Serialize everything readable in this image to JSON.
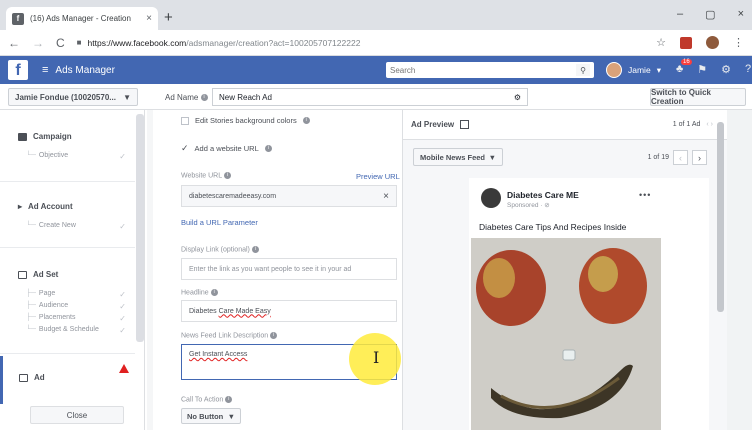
{
  "browser": {
    "tab_title": "(16) Ads Manager - Creation",
    "tab_close": "×",
    "new_tab": "+",
    "back": "←",
    "forward": "→",
    "reload": "C",
    "url_host": "https://www.facebook.com",
    "url_path": "/adsmanager/creation?act=100205707122222",
    "star": "☆",
    "menu": "⋮",
    "minimize": "–",
    "maximize": "▢",
    "close": "×"
  },
  "fb_header": {
    "logo": "f",
    "menu_icon": "≡",
    "title": "Ads Manager",
    "search_placeholder": "Search",
    "user_name": "Jamie",
    "notif_count": "16"
  },
  "toolbar": {
    "account": "Jamie Fondue (10020570...",
    "ad_name_label": "Ad Name",
    "ad_name_value": "New Reach Ad",
    "switch_label": "Switch to Quick Creation"
  },
  "sidebar": {
    "campaign": {
      "label": "Campaign",
      "items": [
        "Objective"
      ]
    },
    "ad_account": {
      "label": "Ad Account",
      "items": [
        "Create New"
      ]
    },
    "ad_set": {
      "label": "Ad Set",
      "items": [
        "Page",
        "Audience",
        "Placements",
        "Budget & Schedule"
      ]
    },
    "ad": {
      "label": "Ad"
    },
    "close_label": "Close"
  },
  "form": {
    "edit_stories": "Edit Stories background colors",
    "add_website": "Add a website URL",
    "website_url_label": "Website URL",
    "preview_url": "Preview URL",
    "website_url_value": "diabetescaremadeeasy.com",
    "build_url": "Build a URL Parameter",
    "display_link_label": "Display Link (optional)",
    "display_link_placeholder": "Enter the link as you want people to see it in your ad",
    "headline_label": "Headline",
    "headline_value_a": "Diabetes ",
    "headline_value_b": "Care Made Easy",
    "desc_label": "News Feed Link Description",
    "desc_value": "Get Instant Access",
    "cta_label": "Call To Action",
    "cta_value": "No Button"
  },
  "preview": {
    "title": "Ad Preview",
    "count": "1 of 1 Ad",
    "placement": "Mobile News Feed",
    "page_count": "1 of 19",
    "page_name": "Diabetes Care ME",
    "sponsored": "Sponsored · ⊘",
    "more": "•••",
    "post_text": "Diabetes Care Tips And Recipes Inside"
  },
  "colors": {
    "fb_blue": "#4267b2",
    "warning_red": "#e02020",
    "highlight_yellow": "#ffeb3b"
  }
}
